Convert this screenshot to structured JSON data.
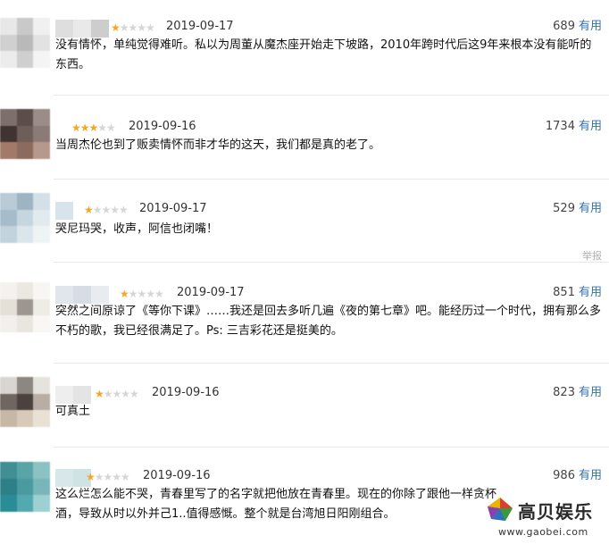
{
  "reviews": [
    {
      "stars": 1,
      "date": "2019-09-17",
      "votes": "689",
      "useful_label": "有用",
      "text": "没有情怀，单纯觉得难听。私以为周董从魔杰座开始走下坡路，2010年跨时代后这9年来根本没有能听的东西。"
    },
    {
      "stars": 3,
      "date": "2019-09-16",
      "votes": "1734",
      "useful_label": "有用",
      "text": "当周杰伦也到了贩卖情怀而非才华的这天，我们都是真的老了。"
    },
    {
      "stars": 1,
      "date": "2019-09-17",
      "votes": "529",
      "useful_label": "有用",
      "text": "哭尼玛哭，收声，阿信也闭嘴！",
      "report": "举报"
    },
    {
      "stars": 1,
      "date": "2019-09-17",
      "votes": "851",
      "useful_label": "有用",
      "text": "突然之间原谅了《等你下课》……我还是回去多听几遍《夜的第七章》吧。能经历过一个时代，拥有那么多不朽的歌，我已经很满足了。Ps: 三吉彩花还是挺美的。"
    },
    {
      "stars": 1,
      "date": "2019-09-16",
      "votes": "823",
      "useful_label": "有用",
      "text": "可真土"
    },
    {
      "stars": 1,
      "date": "2019-09-16",
      "votes": "986",
      "useful_label": "有用",
      "text": "这么烂怎么能不哭，青春里写了的名字就把他放在青春里。现在的你除了跟他一样贪杯酒，导致从时以外并己1..值得感慨。整个就是台湾旭日阳刚组合。"
    }
  ],
  "watermark": {
    "title": "高贝娱乐",
    "url": "www.gaobei.com"
  },
  "colors": {
    "star_on": "#f5a623",
    "star_off": "#d6d6d6",
    "useful": "#2f72b8"
  }
}
